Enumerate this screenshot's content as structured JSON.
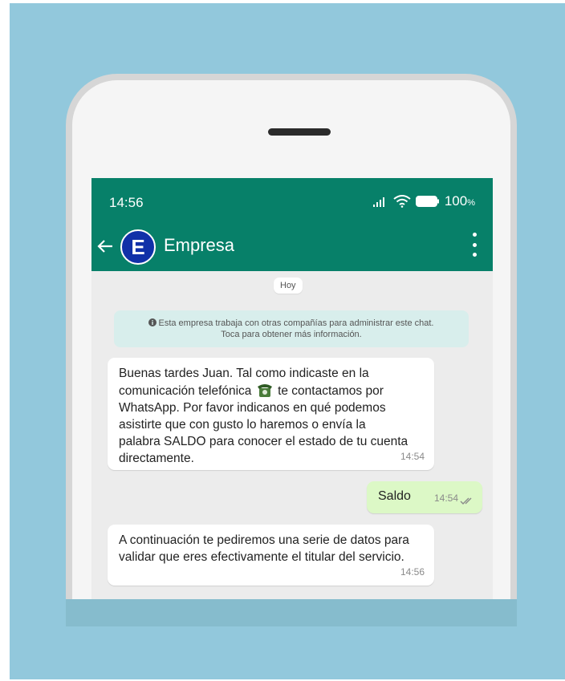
{
  "status_bar": {
    "time": "14:56",
    "battery": "100",
    "battery_unit": "%"
  },
  "header": {
    "avatar_letter": "E",
    "contact_name": "Empresa"
  },
  "chat": {
    "date_label": "Hoy",
    "info_notice": {
      "line1": "Esta empresa trabaja con otras compañías para administrar este chat.",
      "line2": "Toca para obtener más información."
    },
    "messages": [
      {
        "direction": "incoming",
        "lines": [
          "Buenas tardes Juan. Tal como indicaste en la",
          "comunicación telefónica",
          "te contactamos por",
          "WhatsApp. Por favor indicanos en qué podemos",
          "asistirte que con gusto lo haremos o envía la",
          "palabra SALDO para conocer el estado de tu cuenta",
          "directamente."
        ],
        "time": "14:54"
      },
      {
        "direction": "outgoing",
        "text": "Saldo",
        "time": "14:54"
      },
      {
        "direction": "incoming",
        "lines": [
          "A continuación te pediremos una serie de datos para",
          "validar que eres efectivamente el titular del servicio."
        ],
        "time": "14:56"
      }
    ]
  },
  "colors": {
    "app_bar": "#078069",
    "backdrop": "#92c8dc",
    "outgoing_bubble": "#dcf8c6",
    "info_bubble": "#d8eeec",
    "avatar": "#1030a8"
  },
  "icons": [
    "back-arrow-icon",
    "signal-icon",
    "wifi-icon",
    "battery-icon",
    "more-vert-icon",
    "info-icon",
    "telephone-emoji-icon",
    "double-check-icon"
  ]
}
